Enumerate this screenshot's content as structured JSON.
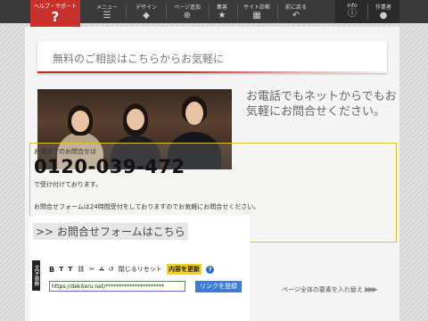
{
  "toolbar": {
    "help": {
      "label": "ヘルプ・サポート",
      "icon": "?"
    },
    "items": [
      {
        "label": "メニュー",
        "icon": "☰"
      },
      {
        "label": "デザイン",
        "icon": "◆"
      },
      {
        "label": "ページ追加",
        "icon": "⊕"
      },
      {
        "label": "集客",
        "icon": "★"
      },
      {
        "label": "サイト診断",
        "icon": "▦"
      },
      {
        "label": "前に戻る",
        "icon": "↶"
      }
    ],
    "right": [
      {
        "label": "Info",
        "icon": "ⓘ"
      },
      {
        "label": "作業者",
        "icon": "●"
      }
    ]
  },
  "banner": {
    "title": "無料のご相談はこちらからお気軽に",
    "accent": "#c0292a"
  },
  "headline": "お電話でもネットからでもお気軽にお問合せください。",
  "phone": {
    "lead": "お電話でのお問合せは",
    "number": "0120-039-472",
    "hours": "で受け付けております。",
    "form_note": "お問合せフォームは24時間受付をしておりますのでお気軽にお問合せください。"
  },
  "editor": {
    "form_link": ">> お問合せフォームはこちら",
    "side_label": "文字装飾",
    "buttons": {
      "bold": "B",
      "t1": "T",
      "t2": "T",
      "reset": "閉じるリセット",
      "update": "内容を更新",
      "help": "?"
    },
    "url_value": "https://dekiteru.net/**********************",
    "link_button": "リンクを登録"
  },
  "page_switch": "ページ全体の要素を入れ替え"
}
